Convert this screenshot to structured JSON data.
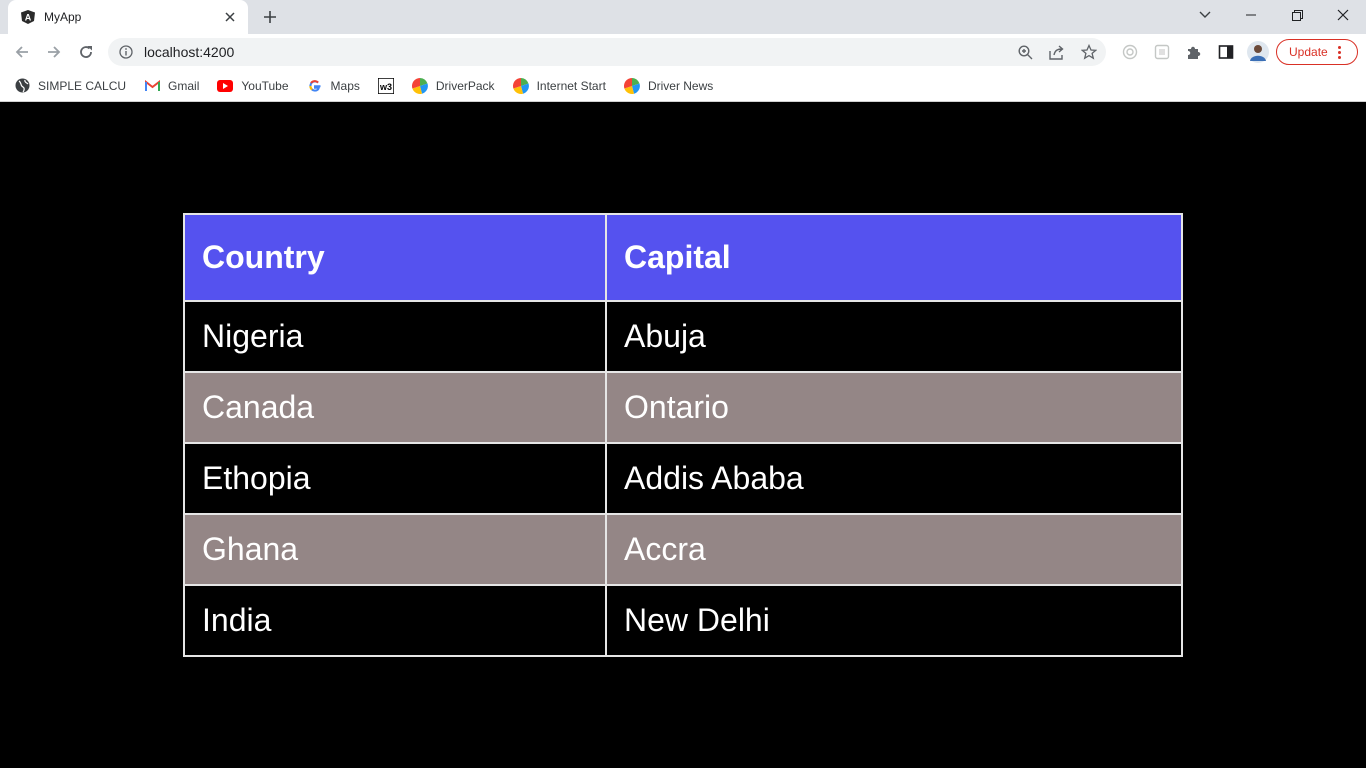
{
  "browser": {
    "tab_title": "MyApp",
    "url": "localhost:4200",
    "update_label": "Update",
    "bookmarks": [
      {
        "label": "SIMPLE CALCU",
        "icon": "globe-icon"
      },
      {
        "label": "Gmail",
        "icon": "gmail-icon"
      },
      {
        "label": "YouTube",
        "icon": "youtube-icon"
      },
      {
        "label": "Maps",
        "icon": "google-icon"
      },
      {
        "label": "",
        "icon": "w3-icon"
      },
      {
        "label": "DriverPack",
        "icon": "driverpack-icon"
      },
      {
        "label": "Internet Start",
        "icon": "driverpack-icon"
      },
      {
        "label": "Driver News",
        "icon": "driverpack-icon"
      }
    ]
  },
  "table": {
    "headers": [
      "Country",
      "Capital"
    ],
    "rows": [
      [
        "Nigeria",
        "Abuja"
      ],
      [
        "Canada",
        "Ontario"
      ],
      [
        "Ethopia",
        "Addis Ababa"
      ],
      [
        "Ghana",
        "Accra"
      ],
      [
        "India",
        "New Delhi"
      ]
    ]
  },
  "colors": {
    "header_bg": "#5552ef",
    "alt_row_bg": "#948686",
    "page_bg": "#000000",
    "update_accent": "#d93025"
  }
}
